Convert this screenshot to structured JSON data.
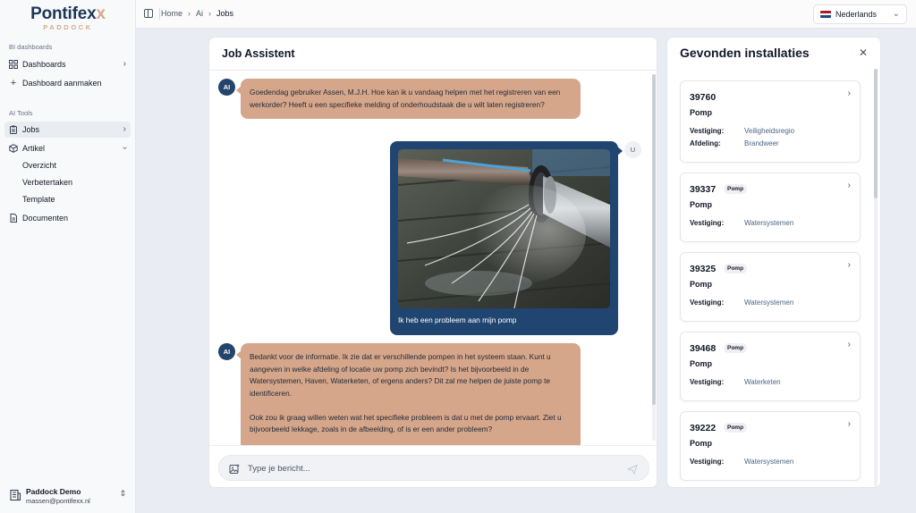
{
  "brand": {
    "name": "Pontifex",
    "name_x": "x",
    "sub": "PADDOCK"
  },
  "sidebar": {
    "section_bi": "BI dashboards",
    "dashboards": "Dashboards",
    "dashboard_create": "Dashboard aanmaken",
    "section_ai": "AI Tools",
    "jobs": "Jobs",
    "artikel": "Artikel",
    "overzicht": "Overzicht",
    "verbetertaken": "Verbetertaken",
    "template": "Template",
    "documenten": "Documenten"
  },
  "user": {
    "name": "Paddock Demo",
    "email": "massen@pontifexx.nl"
  },
  "breadcrumb": {
    "home": "Home",
    "ai": "Ai",
    "current": "Jobs"
  },
  "language": {
    "selected": "Nederlands",
    "flag_colors": [
      "#ae1c28",
      "#ffffff",
      "#21468b"
    ]
  },
  "chat": {
    "title": "Job Assistent",
    "ai_label": "AI",
    "user_label": "U",
    "messages": [
      {
        "from": "ai",
        "text": "Goedendag gebruiker Assen, M.J.H. Hoe kan ik u vandaag helpen met het registreren van een werkorder? Heeft u een specifieke melding of onderhoudstaak die u wilt laten registreren?"
      },
      {
        "from": "user",
        "text": "Ik heb een probleem aan mijn pomp"
      },
      {
        "from": "ai",
        "text": "Bedankt voor de informatie. Ik zie dat er verschillende pompen in het systeem staan. Kunt u aangeven in welke afdeling of locatie uw pomp zich bevindt? Is het bijvoorbeeld in de Watersystemen, Haven, Waterketen, of ergens anders? Dit zal me helpen de juiste pomp te identificeren.",
        "text2": "Ook zou ik graag willen weten wat het specifieke probleem is dat u met de pomp ervaart. Ziet u bijvoorbeeld lekkage, zoals in de afbeelding, of is er een ander probleem?"
      }
    ],
    "input_placeholder": "Type je bericht..."
  },
  "installations": {
    "title": "Gevonden installaties",
    "label_vestiging": "Vestiging:",
    "label_afdeling": "Afdeling:",
    "items": [
      {
        "id": "39760",
        "tag": "",
        "type": "Pomp",
        "vestiging": "Veiligheidsregio",
        "afdeling": "Brandweer"
      },
      {
        "id": "39337",
        "tag": "Pomp",
        "type": "Pomp",
        "vestiging": "Watersystemen"
      },
      {
        "id": "39325",
        "tag": "Pomp",
        "type": "Pomp",
        "vestiging": "Watersystemen"
      },
      {
        "id": "39468",
        "tag": "Pomp",
        "type": "Pomp",
        "vestiging": "Waterketen"
      },
      {
        "id": "39222",
        "tag": "Pomp",
        "type": "Pomp",
        "vestiging": "Watersystemen"
      }
    ]
  },
  "colors": {
    "brand_navy": "#1d3557",
    "accent_peach": "#d6a68b",
    "user_bubble": "#1f4570",
    "ai_avatar": "#24456b"
  }
}
